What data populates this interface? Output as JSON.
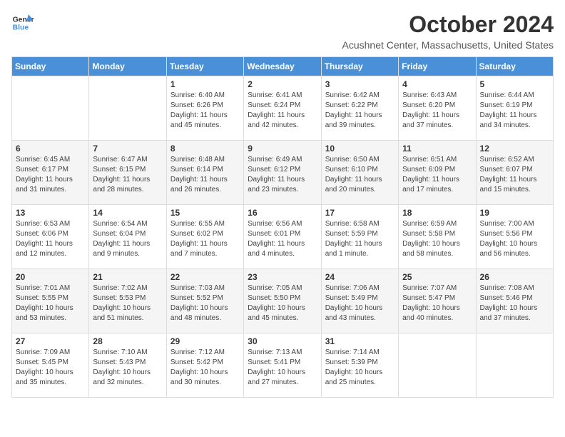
{
  "header": {
    "logo_line1": "General",
    "logo_line2": "Blue",
    "month": "October 2024",
    "location": "Acushnet Center, Massachusetts, United States"
  },
  "days_of_week": [
    "Sunday",
    "Monday",
    "Tuesday",
    "Wednesday",
    "Thursday",
    "Friday",
    "Saturday"
  ],
  "weeks": [
    [
      {
        "day": "",
        "info": ""
      },
      {
        "day": "",
        "info": ""
      },
      {
        "day": "1",
        "info": "Sunrise: 6:40 AM\nSunset: 6:26 PM\nDaylight: 11 hours and 45 minutes."
      },
      {
        "day": "2",
        "info": "Sunrise: 6:41 AM\nSunset: 6:24 PM\nDaylight: 11 hours and 42 minutes."
      },
      {
        "day": "3",
        "info": "Sunrise: 6:42 AM\nSunset: 6:22 PM\nDaylight: 11 hours and 39 minutes."
      },
      {
        "day": "4",
        "info": "Sunrise: 6:43 AM\nSunset: 6:20 PM\nDaylight: 11 hours and 37 minutes."
      },
      {
        "day": "5",
        "info": "Sunrise: 6:44 AM\nSunset: 6:19 PM\nDaylight: 11 hours and 34 minutes."
      }
    ],
    [
      {
        "day": "6",
        "info": "Sunrise: 6:45 AM\nSunset: 6:17 PM\nDaylight: 11 hours and 31 minutes."
      },
      {
        "day": "7",
        "info": "Sunrise: 6:47 AM\nSunset: 6:15 PM\nDaylight: 11 hours and 28 minutes."
      },
      {
        "day": "8",
        "info": "Sunrise: 6:48 AM\nSunset: 6:14 PM\nDaylight: 11 hours and 26 minutes."
      },
      {
        "day": "9",
        "info": "Sunrise: 6:49 AM\nSunset: 6:12 PM\nDaylight: 11 hours and 23 minutes."
      },
      {
        "day": "10",
        "info": "Sunrise: 6:50 AM\nSunset: 6:10 PM\nDaylight: 11 hours and 20 minutes."
      },
      {
        "day": "11",
        "info": "Sunrise: 6:51 AM\nSunset: 6:09 PM\nDaylight: 11 hours and 17 minutes."
      },
      {
        "day": "12",
        "info": "Sunrise: 6:52 AM\nSunset: 6:07 PM\nDaylight: 11 hours and 15 minutes."
      }
    ],
    [
      {
        "day": "13",
        "info": "Sunrise: 6:53 AM\nSunset: 6:06 PM\nDaylight: 11 hours and 12 minutes."
      },
      {
        "day": "14",
        "info": "Sunrise: 6:54 AM\nSunset: 6:04 PM\nDaylight: 11 hours and 9 minutes."
      },
      {
        "day": "15",
        "info": "Sunrise: 6:55 AM\nSunset: 6:02 PM\nDaylight: 11 hours and 7 minutes."
      },
      {
        "day": "16",
        "info": "Sunrise: 6:56 AM\nSunset: 6:01 PM\nDaylight: 11 hours and 4 minutes."
      },
      {
        "day": "17",
        "info": "Sunrise: 6:58 AM\nSunset: 5:59 PM\nDaylight: 11 hours and 1 minute."
      },
      {
        "day": "18",
        "info": "Sunrise: 6:59 AM\nSunset: 5:58 PM\nDaylight: 10 hours and 58 minutes."
      },
      {
        "day": "19",
        "info": "Sunrise: 7:00 AM\nSunset: 5:56 PM\nDaylight: 10 hours and 56 minutes."
      }
    ],
    [
      {
        "day": "20",
        "info": "Sunrise: 7:01 AM\nSunset: 5:55 PM\nDaylight: 10 hours and 53 minutes."
      },
      {
        "day": "21",
        "info": "Sunrise: 7:02 AM\nSunset: 5:53 PM\nDaylight: 10 hours and 51 minutes."
      },
      {
        "day": "22",
        "info": "Sunrise: 7:03 AM\nSunset: 5:52 PM\nDaylight: 10 hours and 48 minutes."
      },
      {
        "day": "23",
        "info": "Sunrise: 7:05 AM\nSunset: 5:50 PM\nDaylight: 10 hours and 45 minutes."
      },
      {
        "day": "24",
        "info": "Sunrise: 7:06 AM\nSunset: 5:49 PM\nDaylight: 10 hours and 43 minutes."
      },
      {
        "day": "25",
        "info": "Sunrise: 7:07 AM\nSunset: 5:47 PM\nDaylight: 10 hours and 40 minutes."
      },
      {
        "day": "26",
        "info": "Sunrise: 7:08 AM\nSunset: 5:46 PM\nDaylight: 10 hours and 37 minutes."
      }
    ],
    [
      {
        "day": "27",
        "info": "Sunrise: 7:09 AM\nSunset: 5:45 PM\nDaylight: 10 hours and 35 minutes."
      },
      {
        "day": "28",
        "info": "Sunrise: 7:10 AM\nSunset: 5:43 PM\nDaylight: 10 hours and 32 minutes."
      },
      {
        "day": "29",
        "info": "Sunrise: 7:12 AM\nSunset: 5:42 PM\nDaylight: 10 hours and 30 minutes."
      },
      {
        "day": "30",
        "info": "Sunrise: 7:13 AM\nSunset: 5:41 PM\nDaylight: 10 hours and 27 minutes."
      },
      {
        "day": "31",
        "info": "Sunrise: 7:14 AM\nSunset: 5:39 PM\nDaylight: 10 hours and 25 minutes."
      },
      {
        "day": "",
        "info": ""
      },
      {
        "day": "",
        "info": ""
      }
    ]
  ]
}
